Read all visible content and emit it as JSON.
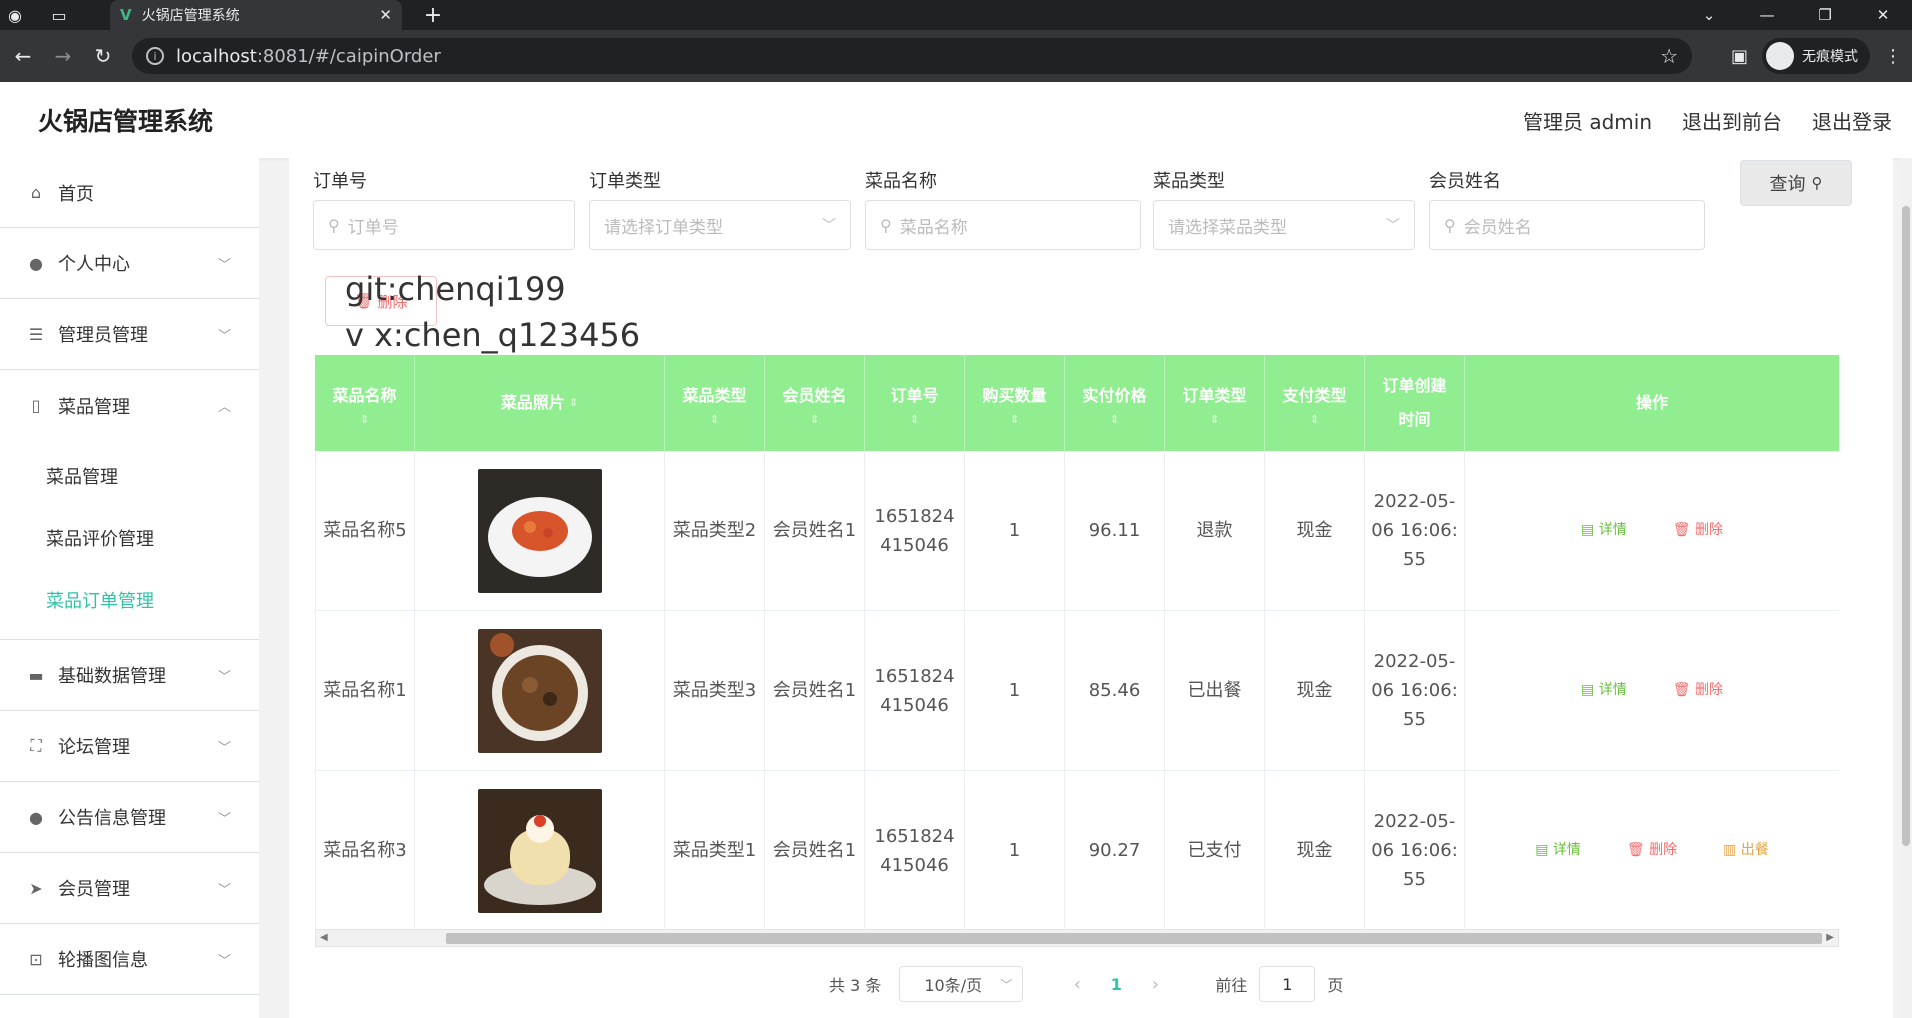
{
  "browser": {
    "tab_title": "火锅店管理系统",
    "url_host": "localhost",
    "url_path": ":8081/#/caipinOrder",
    "incognito_label": "无痕模式"
  },
  "header": {
    "title": "火锅店管理系统",
    "user_label": "管理员 admin",
    "exit_front": "退出到前台",
    "logout": "退出登录"
  },
  "sidebar": {
    "items": [
      {
        "label": "首页",
        "icon": "home-icon"
      },
      {
        "label": "个人中心",
        "icon": "person-icon"
      },
      {
        "label": "管理员管理",
        "icon": "list-icon"
      },
      {
        "label": "菜品管理",
        "icon": "phone-icon"
      },
      {
        "label": "基础数据管理",
        "icon": "ticket-icon"
      },
      {
        "label": "论坛管理",
        "icon": "frame-icon"
      },
      {
        "label": "公告信息管理",
        "icon": "person-icon"
      },
      {
        "label": "会员管理",
        "icon": "send-icon"
      },
      {
        "label": "轮播图信息",
        "icon": "crop-icon"
      }
    ],
    "sub_items": [
      "菜品管理",
      "菜品评价管理",
      "菜品订单管理"
    ]
  },
  "filters": {
    "order_no_label": "订单号",
    "order_no_placeholder": "订单号",
    "order_type_label": "订单类型",
    "order_type_placeholder": "请选择订单类型",
    "dish_name_label": "菜品名称",
    "dish_name_placeholder": "菜品名称",
    "dish_type_label": "菜品类型",
    "dish_type_placeholder": "请选择菜品类型",
    "member_label": "会员姓名",
    "member_placeholder": "会员姓名",
    "query_button": "查询"
  },
  "delete_button": "删除",
  "watermark": {
    "line1": "git:chenqi199",
    "line2": "v x:chen_q123456"
  },
  "table": {
    "headers": [
      "菜品名称",
      "菜品照片",
      "菜品类型",
      "会员姓名",
      "订单号",
      "购买数量",
      "实付价格",
      "订单类型",
      "支付类型",
      "订单创建时间",
      "操作"
    ],
    "rows": [
      {
        "dish": "菜品名称5",
        "photo_color": "#2e2a26",
        "type": "菜品类型2",
        "member": "会员姓名1",
        "order_no": "1651824415046",
        "qty": "1",
        "price": "96.11",
        "order_type": "退款",
        "pay": "现金",
        "created": "2022-05-06 16:06:55",
        "ops": [
          "详情",
          "删除"
        ]
      },
      {
        "dish": "菜品名称1",
        "photo_color": "#4a3426",
        "type": "菜品类型3",
        "member": "会员姓名1",
        "order_no": "1651824415046",
        "qty": "1",
        "price": "85.46",
        "order_type": "已出餐",
        "pay": "现金",
        "created": "2022-05-06 16:06:55",
        "ops": [
          "详情",
          "删除"
        ]
      },
      {
        "dish": "菜品名称3",
        "photo_color": "#3b2a1e",
        "type": "菜品类型1",
        "member": "会员姓名1",
        "order_no": "1651824415046",
        "qty": "1",
        "price": "90.27",
        "order_type": "已支付",
        "pay": "现金",
        "created": "2022-05-06 16:06:55",
        "ops": [
          "详情",
          "删除",
          "出餐"
        ]
      }
    ]
  },
  "pagination": {
    "total": "共 3 条",
    "page_size": "10条/页",
    "current": "1",
    "goto_label": "前往",
    "goto_value": "1",
    "page_suffix": "页"
  },
  "colors": {
    "accent": "#2fc4a8",
    "table_header": "#90ee90",
    "detail": "#67c23a",
    "delete": "#f56c6c",
    "serve": "#e6a23c"
  }
}
